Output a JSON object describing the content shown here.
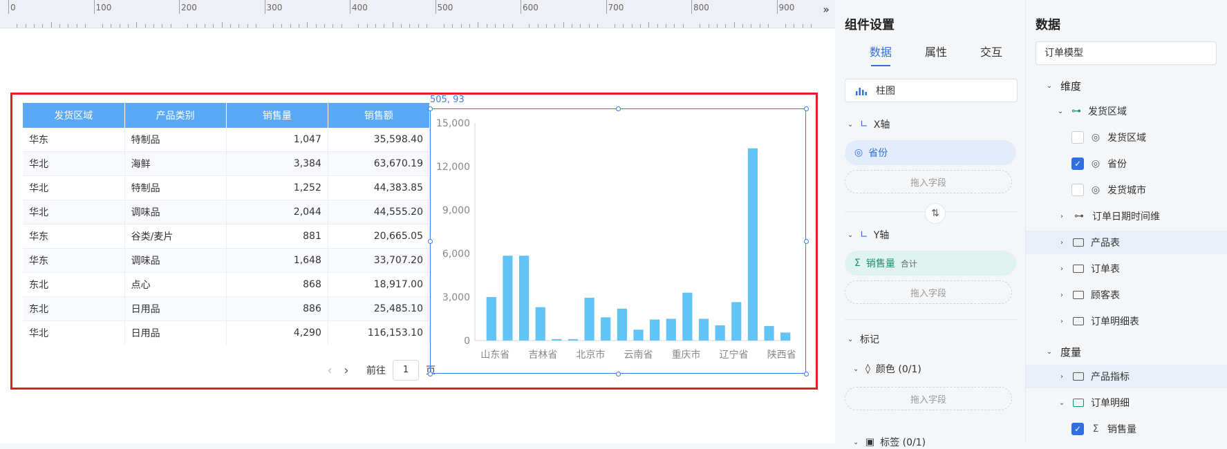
{
  "ruler": {
    "labels": [
      "0",
      "100",
      "200",
      "300",
      "400",
      "500",
      "600",
      "700",
      "800",
      "900"
    ]
  },
  "table": {
    "columns": [
      "发货区域",
      "产品类别",
      "销售量",
      "销售额"
    ],
    "rows": [
      {
        "region": "华东",
        "category": "特制品",
        "qty": "1,047",
        "amount": "35,598.40"
      },
      {
        "region": "华北",
        "category": "海鲜",
        "qty": "3,384",
        "amount": "63,670.19"
      },
      {
        "region": "华北",
        "category": "特制品",
        "qty": "1,252",
        "amount": "44,383.85"
      },
      {
        "region": "华北",
        "category": "调味品",
        "qty": "2,044",
        "amount": "44,555.20"
      },
      {
        "region": "华东",
        "category": "谷类/麦片",
        "qty": "881",
        "amount": "20,665.05"
      },
      {
        "region": "华东",
        "category": "调味品",
        "qty": "1,648",
        "amount": "33,707.20"
      },
      {
        "region": "东北",
        "category": "点心",
        "qty": "868",
        "amount": "18,917.00"
      },
      {
        "region": "东北",
        "category": "日用品",
        "qty": "886",
        "amount": "25,485.10"
      },
      {
        "region": "华北",
        "category": "日用品",
        "qty": "4,290",
        "amount": "116,153.10"
      }
    ],
    "pager": {
      "goto_label": "前往",
      "page_value": "1",
      "page_suffix": "页"
    }
  },
  "chart_widget": {
    "coord_readout": "505, 93"
  },
  "chart_data": {
    "type": "bar",
    "ylim": [
      0,
      15000
    ],
    "yticks": [
      "0",
      "3,000",
      "6,000",
      "9,000",
      "12,000",
      "15,000"
    ],
    "ytick_values": [
      0,
      3000,
      6000,
      9000,
      12000,
      15000
    ],
    "categories": [
      "山东省",
      "",
      "吉林省",
      "",
      "北京市",
      "",
      "云南省",
      "",
      "重庆市",
      "",
      "辽宁省",
      "",
      "陕西省"
    ],
    "values": [
      3000,
      5850,
      5850,
      2300,
      100,
      100,
      2950,
      1600,
      2200,
      750,
      1450,
      1500,
      3300,
      1500,
      1050,
      2650,
      13250,
      1000,
      550
    ],
    "bar_color": "#62c3f7",
    "grid": false
  },
  "settings": {
    "title": "组件设置",
    "tabs": [
      "数据",
      "属性",
      "交互"
    ],
    "chart_type": "柱图",
    "x_axis": {
      "label": "X轴",
      "field": "省份",
      "drop_hint": "拖入字段"
    },
    "y_axis": {
      "label": "Y轴",
      "field": "销售量",
      "agg": "合计",
      "drop_hint": "拖入字段"
    },
    "marks": {
      "label": "标记",
      "color_label": "颜色 (0/1)",
      "drop_hint": "拖入字段",
      "tooltip_label": "标签 (0/1)"
    }
  },
  "data_panel": {
    "title": "数据",
    "model": "订单模型",
    "dimension_label": "维度",
    "dim_group": "发货区域",
    "dim_fields": [
      {
        "name": "发货区域",
        "checked": false
      },
      {
        "name": "省份",
        "checked": true
      },
      {
        "name": "发货城市",
        "checked": false
      }
    ],
    "dim_nodes": [
      "订单日期时间维",
      "产品表",
      "订单表",
      "顾客表",
      "订单明细表"
    ],
    "measure_label": "度量",
    "measure_nodes": [
      "产品指标",
      "订单明细"
    ],
    "measure_fields": [
      {
        "name": "销售量",
        "checked": true
      }
    ]
  },
  "colors": {
    "accent": "#2f6fe0",
    "table_header": "#5aa9f5",
    "selection_border": "#e02020"
  }
}
